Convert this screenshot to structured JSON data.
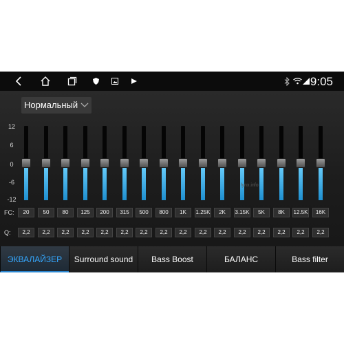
{
  "status": {
    "time": "9:05"
  },
  "nav_icons": [
    "back-icon",
    "home-icon",
    "recents-icon"
  ],
  "notif_icons": [
    "shield-icon",
    "image-icon",
    "play-icon"
  ],
  "equalizer": {
    "preset": "Нормальный",
    "y_labels": [
      "12",
      "6",
      "0",
      "-6",
      "-12"
    ],
    "fc_label": "FC:",
    "q_label": "Q:",
    "bands": [
      {
        "fc": "20",
        "q": "2,2",
        "level": 0
      },
      {
        "fc": "50",
        "q": "2,2",
        "level": 0
      },
      {
        "fc": "80",
        "q": "2,2",
        "level": 0
      },
      {
        "fc": "125",
        "q": "2,2",
        "level": 0
      },
      {
        "fc": "200",
        "q": "2,2",
        "level": 0
      },
      {
        "fc": "315",
        "q": "2,2",
        "level": 0
      },
      {
        "fc": "500",
        "q": "2,2",
        "level": 0
      },
      {
        "fc": "800",
        "q": "2,2",
        "level": 0
      },
      {
        "fc": "1K",
        "q": "2,2",
        "level": 0
      },
      {
        "fc": "1.25K",
        "q": "2,2",
        "level": 0
      },
      {
        "fc": "2K",
        "q": "2,2",
        "level": 0
      },
      {
        "fc": "3.15K",
        "q": "2,2",
        "level": 0
      },
      {
        "fc": "5K",
        "q": "2,2",
        "level": 0
      },
      {
        "fc": "8K",
        "q": "2,2",
        "level": 0
      },
      {
        "fc": "12.5K",
        "q": "2,2",
        "level": 0
      },
      {
        "fc": "16K",
        "q": "2,2",
        "level": 0
      }
    ],
    "range": [
      -12,
      12
    ],
    "watermark": "lynx.info"
  },
  "tabs": [
    {
      "label": "ЭКВАЛАЙЗЕР",
      "active": true
    },
    {
      "label": "Surround sound",
      "active": false
    },
    {
      "label": "Bass Boost",
      "active": false
    },
    {
      "label": "БАЛАНС",
      "active": false
    },
    {
      "label": "Bass filter",
      "active": false
    }
  ],
  "colors": {
    "accent": "#35a8ff",
    "slider_fill": "#3bb4f0",
    "background": "#1a1a1a"
  }
}
